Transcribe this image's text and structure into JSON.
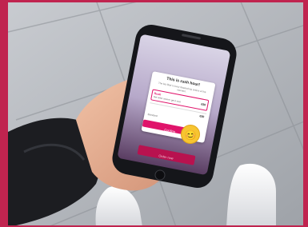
{
  "photo": {
    "subject": "hand holding smartphone"
  },
  "app": {
    "alert_title": "This is rush hour!",
    "alert_body": "The bot fleet is busy dispatching orders at the moment.",
    "option_selected_label": "Rush",
    "option_selected_desc": "Get order sooner, get it next",
    "option_selected_price": "€50",
    "option_other_label": "Standard",
    "option_other_price": "€50",
    "confirm_label": "Confirm",
    "footer_button": "Order now",
    "emoji": "😊"
  },
  "colors": {
    "accent": "#e0146b",
    "frame": "#c0244f"
  }
}
